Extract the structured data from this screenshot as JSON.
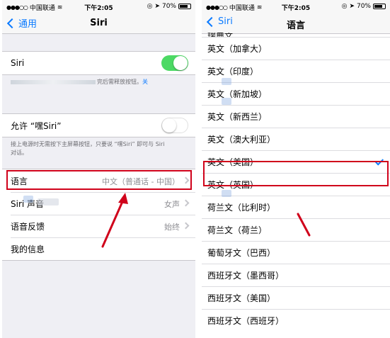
{
  "status_bar": {
    "carrier": "中国联通",
    "time": "下午2:05",
    "battery": "70%"
  },
  "left": {
    "back_label": "通用",
    "title": "Siri",
    "siri_row": {
      "label": "Siri",
      "toggle_on": true
    },
    "siri_footnote": "完后需释放按钮。",
    "siri_footnote_link": "关",
    "hey_siri_row": {
      "label": "允许 “嘿Siri”",
      "toggle_on": false
    },
    "hey_siri_footnote_line1": "接上电源时无需按下主屏幕按钮，只要说 “嘿Siri” 即可与 Siri",
    "hey_siri_footnote_line2": "对话。",
    "settings": [
      {
        "label": "语言",
        "value": "中文（普通话 - 中国）"
      },
      {
        "label": "Siri 声音",
        "value": "女声"
      },
      {
        "label": "语音反馈",
        "value": "始终"
      },
      {
        "label": "我的信息",
        "value": ""
      }
    ]
  },
  "right": {
    "back_label": "Siri",
    "title": "语言",
    "partial_item": "瑞典文",
    "languages": [
      {
        "label": "英文（加拿大）",
        "selected": false
      },
      {
        "label": "英文（印度）",
        "selected": false
      },
      {
        "label": "英文（新加坡）",
        "selected": false
      },
      {
        "label": "英文（新西兰）",
        "selected": false
      },
      {
        "label": "英文（澳大利亚）",
        "selected": false
      },
      {
        "label": "英文（美国）",
        "selected": true
      },
      {
        "label": "英文（英国）",
        "selected": false
      },
      {
        "label": "荷兰文（比利时）",
        "selected": false
      },
      {
        "label": "荷兰文（荷兰）",
        "selected": false
      },
      {
        "label": "葡萄牙文（巴西）",
        "selected": false
      },
      {
        "label": "西班牙文（墨西哥）",
        "selected": false
      },
      {
        "label": "西班牙文（美国）",
        "selected": false
      },
      {
        "label": "西班牙文（西班牙）",
        "selected": false
      }
    ]
  },
  "colors": {
    "accent": "#0a7aff",
    "toggle_on": "#4cd964",
    "highlight": "#d0021b"
  }
}
